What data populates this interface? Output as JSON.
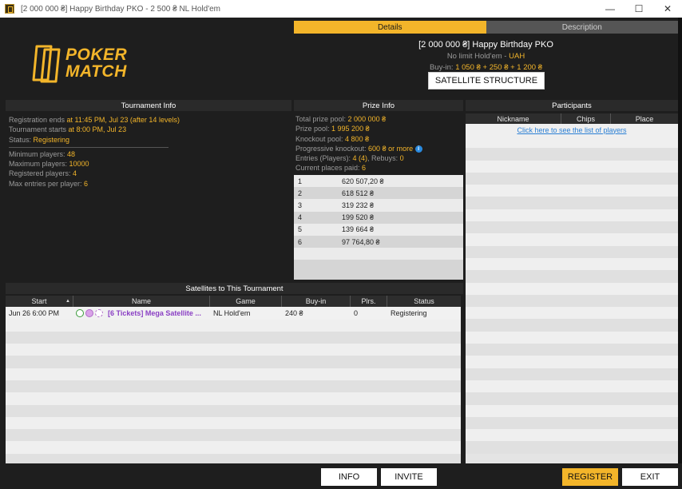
{
  "window": {
    "title": "[2 000 000 ₴] Happy Birthday PKO - 2 500 ₴ NL Hold'em",
    "minimize": "—",
    "maximize": "☐",
    "close": "✕"
  },
  "logo": {
    "line1": "POKER",
    "line2": "MATCH"
  },
  "tabs": {
    "details": "Details",
    "description": "Description"
  },
  "header": {
    "tournament_name": "[2 000 000 ₴] Happy Birthday PKO",
    "game_prefix": "No limit Hold'em - ",
    "currency": "UAH",
    "buyin_label": "Buy-in: ",
    "buyin_value": "1 050 ₴ + 250 ₴ + 1 200 ₴"
  },
  "satellite_structure_button": "SATELLITE STRUCTURE",
  "tournament_info": {
    "heading": "Tournament Info",
    "reg_label": "Registration ends ",
    "reg_value": "at 11:45 PM, Jul 23 (after 14 levels)",
    "start_label": "Tournament starts ",
    "start_value": "at 8:00 PM, Jul 23",
    "status_label": "Status: ",
    "status_value": "Registering",
    "min_label": "Minimum players: ",
    "min_value": "48",
    "max_label": "Maximum players: ",
    "max_value": "10000",
    "registered_label": "Registered players: ",
    "registered_value": "4",
    "maxentries_label": "Max entries per player: ",
    "maxentries_value": "6"
  },
  "prize_info": {
    "heading": "Prize Info",
    "total_label": "Total prize pool: ",
    "total_value": "2 000 000 ₴",
    "pool_label": "Prize pool: ",
    "pool_value": "1 995 200 ₴",
    "ko_label": "Knockout pool: ",
    "ko_value": "4 800 ₴",
    "pko_label": "Progressive knockout: ",
    "pko_value": "600 ₴ or more",
    "entries_label": "Entries (Players): ",
    "entries_value": "4 (4)",
    "rebuys_label": ", Rebuys: ",
    "rebuys_value": "0",
    "places_label": "Current places paid: ",
    "places_value": "6",
    "payouts": [
      {
        "place": "1",
        "amount": "620 507,20 ₴"
      },
      {
        "place": "2",
        "amount": "618 512 ₴"
      },
      {
        "place": "3",
        "amount": "319 232 ₴"
      },
      {
        "place": "4",
        "amount": "199 520 ₴"
      },
      {
        "place": "5",
        "amount": "139 664 ₴"
      },
      {
        "place": "6",
        "amount": "97 764,80 ₴"
      }
    ]
  },
  "participants": {
    "heading": "Participants",
    "col_nickname": "Nickname",
    "col_chips": "Chips",
    "col_place": "Place",
    "link": "Click here to see the list of players"
  },
  "satellites": {
    "heading": "Satellites to This Tournament",
    "columns": {
      "start": "Start",
      "name": "Name",
      "game": "Game",
      "buyin": "Buy-in",
      "plrs": "Plrs.",
      "status": "Status"
    },
    "rows": [
      {
        "start": "Jun 26 6:00 PM",
        "name": "[6 Tickets] Mega Satellite ...",
        "game": "NL Hold'em",
        "buyin": "240 ₴",
        "plrs": "0",
        "status": "Registering"
      }
    ]
  },
  "buttons": {
    "info": "INFO",
    "invite": "INVITE",
    "register": "REGISTER",
    "exit": "EXIT"
  },
  "colors": {
    "accent": "#f3b52a",
    "panel": "#2a2a2a",
    "link": "#2a7fd4",
    "satellite_name": "#8a3fc4"
  }
}
